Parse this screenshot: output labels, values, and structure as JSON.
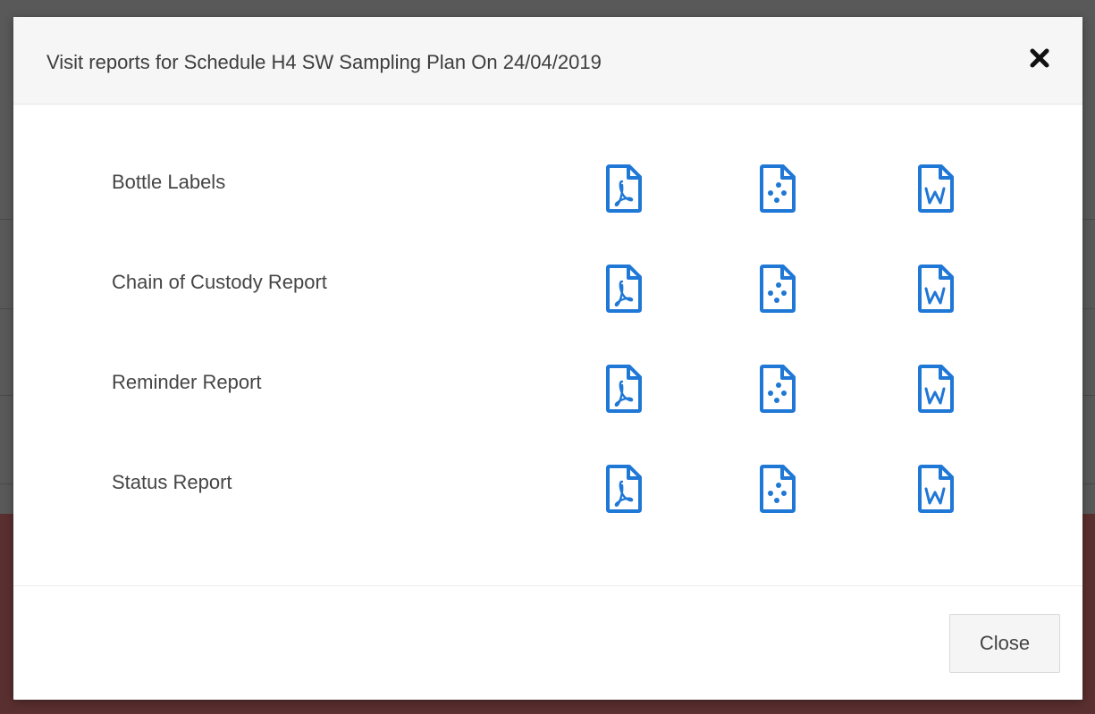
{
  "modal": {
    "title": "Visit reports for Schedule H4 SW Sampling Plan On 24/04/2019",
    "close_icon": "close-x-icon",
    "close_button_label": "Close"
  },
  "reports": [
    {
      "label": "Bottle Labels"
    },
    {
      "label": "Chain of Custody Report"
    },
    {
      "label": "Reminder Report"
    },
    {
      "label": "Status Report"
    }
  ],
  "formats": [
    {
      "icon": "pdf-file-icon"
    },
    {
      "icon": "data-file-icon"
    },
    {
      "icon": "word-file-icon"
    }
  ],
  "colors": {
    "icon_blue": "#1f77d6",
    "backdrop": "#595959",
    "background_band": "#5a2f2f",
    "header_bg": "#f6f6f6"
  }
}
